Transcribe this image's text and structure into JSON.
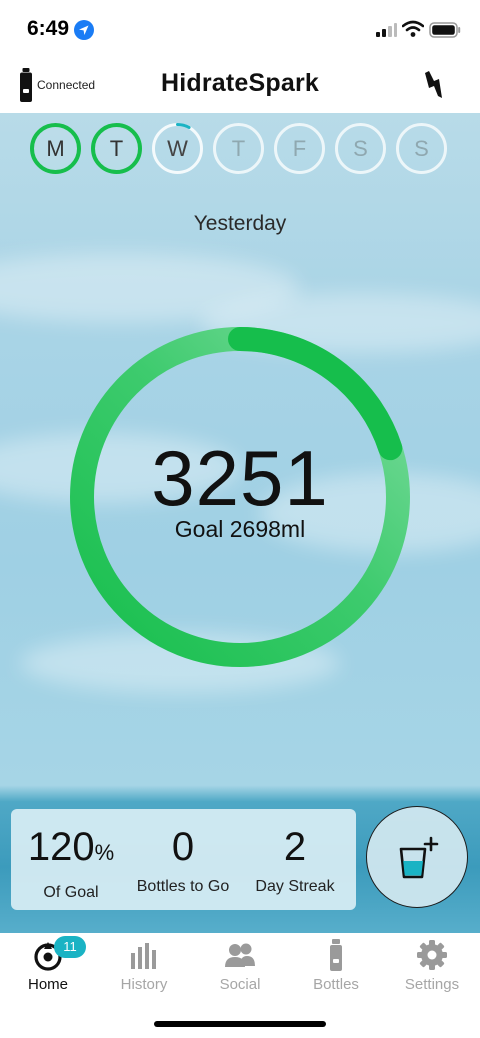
{
  "status_bar": {
    "time": "6:49"
  },
  "header": {
    "connection_status": "Connected",
    "title": "HidrateSpark"
  },
  "week": {
    "days": [
      {
        "label": "M",
        "state": "done"
      },
      {
        "label": "T",
        "state": "done"
      },
      {
        "label": "W",
        "state": "today",
        "progress": 0.08
      },
      {
        "label": "T",
        "state": "future"
      },
      {
        "label": "F",
        "state": "future"
      },
      {
        "label": "S",
        "state": "future"
      },
      {
        "label": "S",
        "state": "future"
      }
    ]
  },
  "main": {
    "day_label": "Yesterday",
    "intake_value": "3251",
    "goal_text": "Goal 2698ml",
    "progress_percent": 120
  },
  "stats": {
    "of_goal": {
      "value": "120",
      "unit": "%",
      "label": "Of Goal"
    },
    "bottles_to_go": {
      "value": "0",
      "label": "Bottles to Go"
    },
    "day_streak": {
      "value": "2",
      "label": "Day Streak"
    }
  },
  "tabs": [
    {
      "label": "Home",
      "icon": "home-drop-icon",
      "active": true,
      "badge": "11"
    },
    {
      "label": "History",
      "icon": "bar-chart-icon",
      "active": false
    },
    {
      "label": "Social",
      "icon": "people-icon",
      "active": false
    },
    {
      "label": "Bottles",
      "icon": "bottle-icon",
      "active": false
    },
    {
      "label": "Settings",
      "icon": "gear-icon",
      "active": false
    }
  ],
  "colors": {
    "accent_green": "#16be4c",
    "light_green": "#5fd48a",
    "badge": "#1ab3c4"
  }
}
